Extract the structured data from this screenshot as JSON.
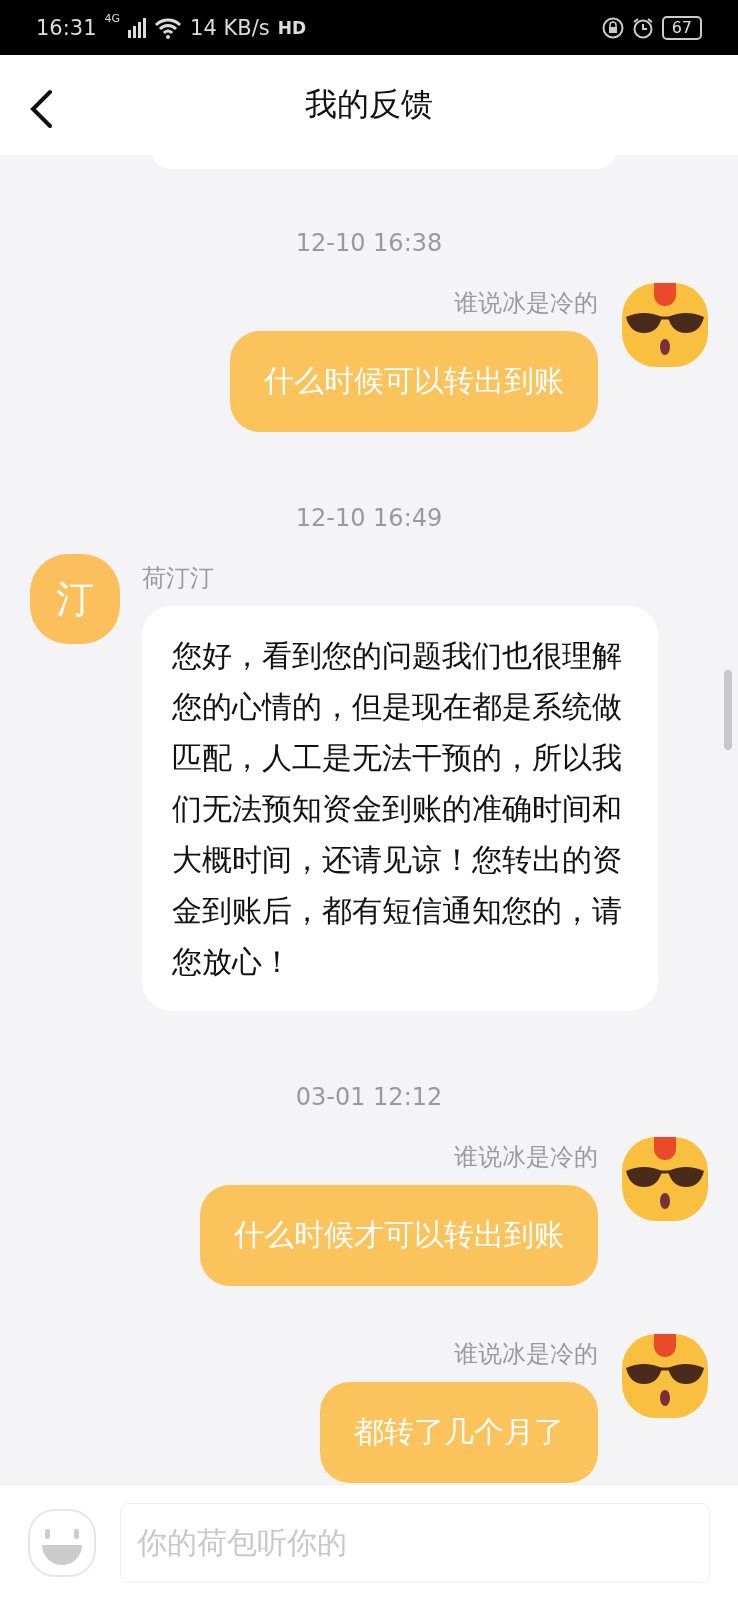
{
  "status_bar": {
    "time": "16:31",
    "network": "4G",
    "speed": "14 KB/s",
    "hd": "HD",
    "battery": "67"
  },
  "header": {
    "title": "我的反馈"
  },
  "messages": [
    {
      "kind": "time",
      "text": "12-10 16:38"
    },
    {
      "kind": "sent",
      "name": "谁说冰是冷的",
      "text": "什么时候可以转出到账"
    },
    {
      "kind": "time",
      "text": "12-10 16:49"
    },
    {
      "kind": "received",
      "name": "荷汀汀",
      "avatar_text": "汀",
      "text": "您好，看到您的问题我们也很理解您的心情的，但是现在都是系统做匹配，人工是无法干预的，所以我们无法预知资金到账的准确时间和大概时间，还请见谅！您转出的资金到账后，都有短信通知您的，请您放心！"
    },
    {
      "kind": "time",
      "text": "03-01 12:12"
    },
    {
      "kind": "sent",
      "name": "谁说冰是冷的",
      "text": "什么时候才可以转出到账"
    },
    {
      "kind": "sent",
      "name": "谁说冰是冷的",
      "text": "都转了几个月了"
    }
  ],
  "input": {
    "placeholder": "你的荷包听你的"
  }
}
